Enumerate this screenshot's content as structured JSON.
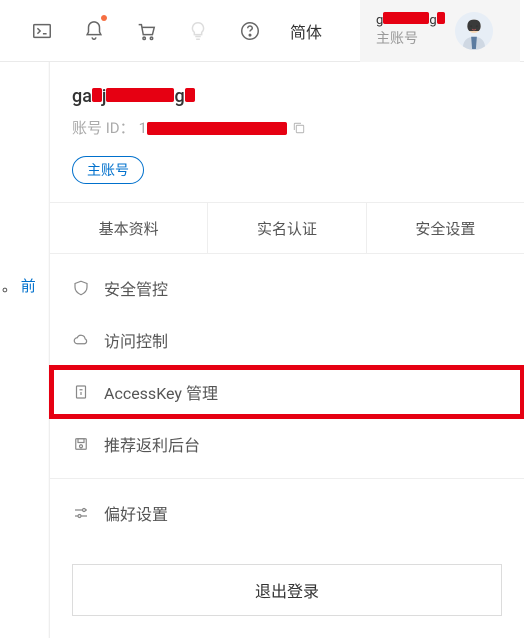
{
  "topbar": {
    "lang_label": "简体",
    "account_name": "g██████g█",
    "account_type": "主账号"
  },
  "profile": {
    "username": "ga█j███████g█",
    "id_label": "账号 ID：",
    "id_value": "1███████████",
    "badge": "主账号"
  },
  "tabs": [
    {
      "label": "基本资料"
    },
    {
      "label": "实名认证"
    },
    {
      "label": "安全设置"
    }
  ],
  "behind": {
    "text_period": "。",
    "text_blue": "前"
  },
  "menu": {
    "items": [
      {
        "label": "安全管控"
      },
      {
        "label": "访问控制"
      },
      {
        "label": "AccessKey 管理"
      },
      {
        "label": "推荐返利后台"
      }
    ],
    "preferences": "偏好设置"
  },
  "logout": {
    "label": "退出登录"
  }
}
